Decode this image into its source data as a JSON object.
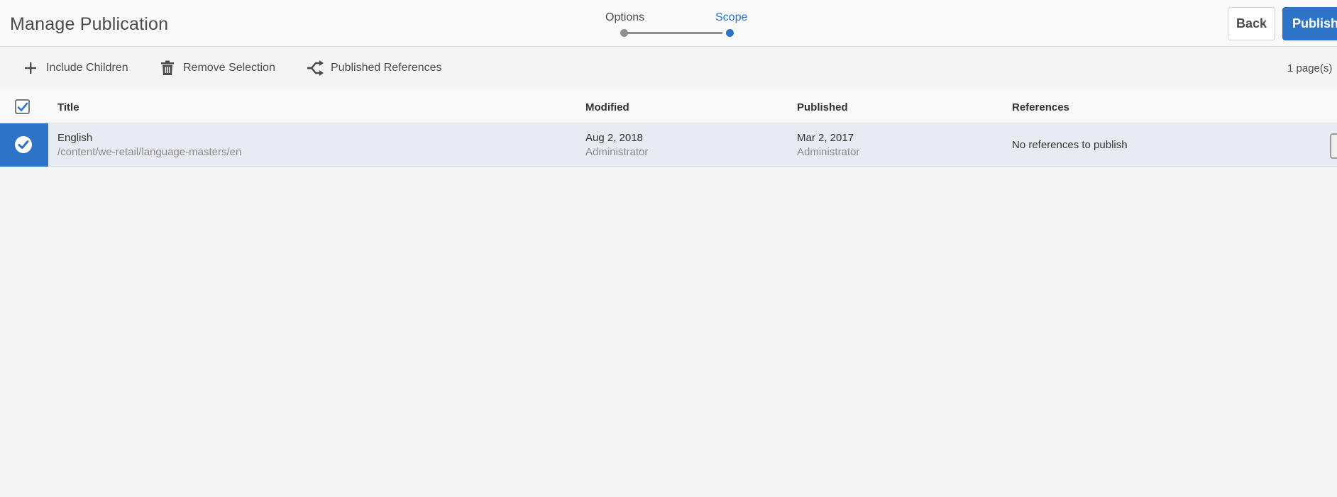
{
  "header": {
    "title": "Manage Publication",
    "wizard": {
      "steps": [
        {
          "label": "Options",
          "active": false
        },
        {
          "label": "Scope",
          "active": true
        }
      ]
    },
    "back_label": "Back",
    "publish_label": "Publish"
  },
  "actionbar": {
    "include_children": {
      "label": "Include Children",
      "icon": "plus-icon"
    },
    "remove_selection": {
      "label": "Remove Selection",
      "icon": "trash-icon"
    },
    "published_references": {
      "label": "Published References",
      "icon": "references-icon"
    },
    "page_count": "1 page(s)"
  },
  "table": {
    "columns": [
      "Title",
      "Modified",
      "Published",
      "References"
    ],
    "header_checked": true,
    "rows": [
      {
        "selected": true,
        "title": "English",
        "path": "/content/we-retail/language-masters/en",
        "modified_date": "Aug 2, 2018",
        "modified_by": "Administrator",
        "published_date": "Mar 2, 2017",
        "published_by": "Administrator",
        "references": "No references to publish"
      }
    ]
  },
  "colors": {
    "accent": "#2d74c8",
    "row_selected_bg": "#e8ecf2",
    "page_bg": "#f5f5f5"
  }
}
